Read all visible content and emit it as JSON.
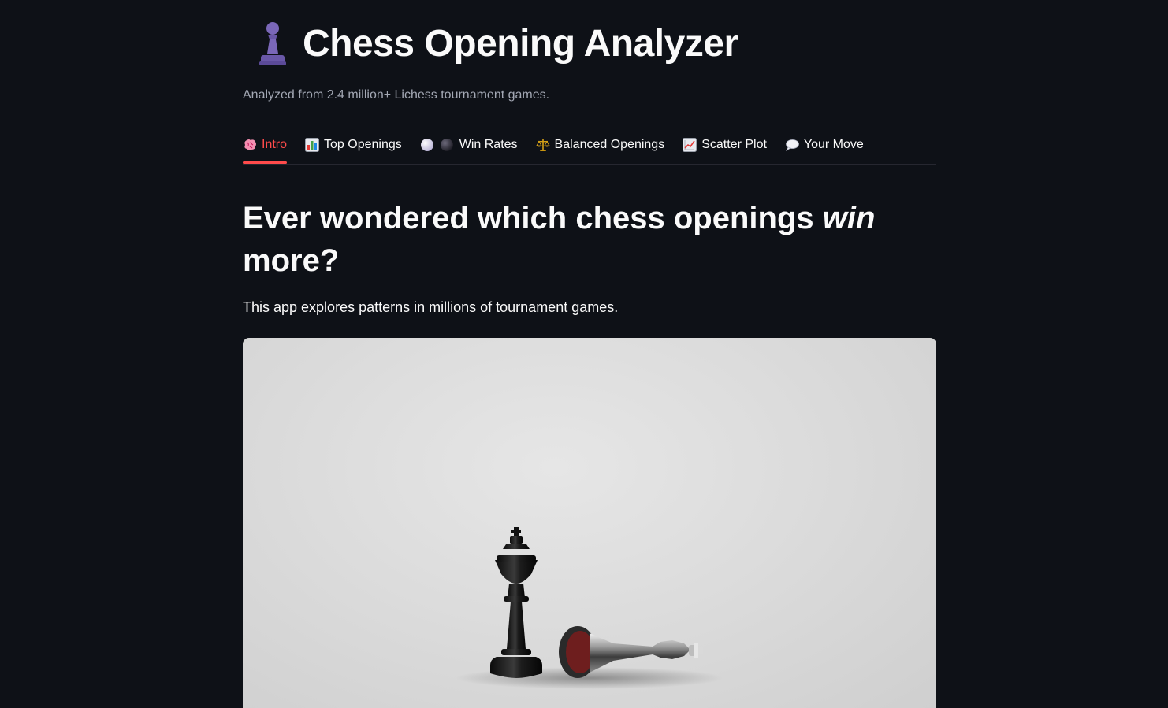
{
  "header": {
    "title": "Chess Opening Analyzer",
    "title_icon": "pawn-icon",
    "subtitle": "Analyzed from 2.4 million+ Lichess tournament games."
  },
  "tabs": [
    {
      "label": "Intro",
      "icon": "brain-icon",
      "active": true
    },
    {
      "label": "Top Openings",
      "icon": "bar-chart-icon",
      "active": false
    },
    {
      "label": "Win Rates",
      "icon": "white-black-circles-icon",
      "active": false
    },
    {
      "label": "Balanced Openings",
      "icon": "balance-scale-icon",
      "active": false
    },
    {
      "label": "Scatter Plot",
      "icon": "chart-increasing-icon",
      "active": false
    },
    {
      "label": "Your Move",
      "icon": "speech-bubble-icon",
      "active": false
    }
  ],
  "main": {
    "headline_part1": "Ever wondered which chess openings ",
    "headline_em": "win",
    "headline_part2": " more?",
    "intro_text": "This app explores patterns in millions of tournament games.",
    "image_subject": "black king standing beside fallen silver king"
  },
  "colors": {
    "background": "#0e1117",
    "accent": "#ff4b4b",
    "text": "#fafafa",
    "muted": "#a3a8b4"
  }
}
